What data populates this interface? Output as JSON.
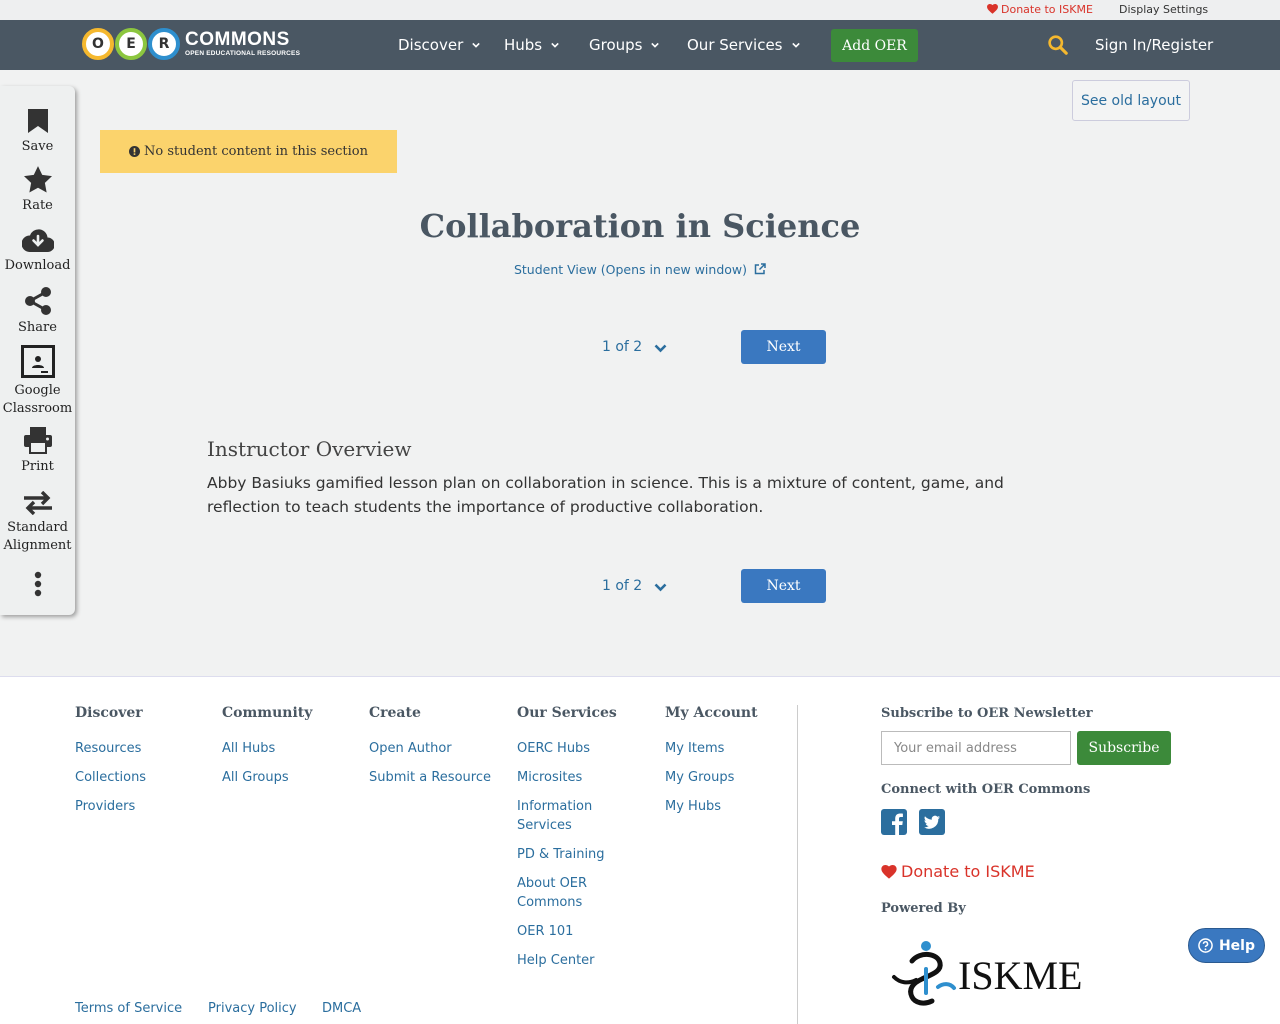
{
  "utility": {
    "donate": "Donate to ISKME",
    "display_settings": "Display Settings"
  },
  "logo": {
    "letters": [
      "O",
      "E",
      "R"
    ],
    "wordmark": "COMMONS",
    "tagline": "OPEN EDUCATIONAL RESOURCES"
  },
  "nav": {
    "items": [
      {
        "label": "Discover"
      },
      {
        "label": "Hubs"
      },
      {
        "label": "Groups"
      },
      {
        "label": "Our Services"
      }
    ],
    "add_oer": "Add OER",
    "sign_in": "Sign In/Register"
  },
  "tools": [
    {
      "label": "Save",
      "icon": "bookmark-icon"
    },
    {
      "label": "Rate",
      "icon": "star-icon"
    },
    {
      "label": "Download",
      "icon": "cloud-download-icon"
    },
    {
      "label": "Share",
      "icon": "share-icon"
    },
    {
      "label": "Google Classroom",
      "icon": "google-classroom-icon"
    },
    {
      "label": "Print",
      "icon": "print-icon"
    },
    {
      "label": "Standard Alignment",
      "icon": "exchange-icon"
    },
    {
      "label": "",
      "icon": "more-vertical-icon"
    }
  ],
  "see_old_layout": "See old layout",
  "notice": "No student content in this section",
  "title": "Collaboration in Science",
  "student_view": "Student View (Opens in new window)",
  "pager": {
    "label": "1 of 2",
    "next": "Next"
  },
  "section": {
    "title": "Instructor Overview",
    "body": "Abby Basiuks gamified lesson plan on collaboration in science. This is a mixture of content, game, and reflection to teach students the importance of productive collaboration."
  },
  "footer": {
    "columns": [
      {
        "title": "Discover",
        "links": [
          "Resources",
          "Collections",
          "Providers"
        ]
      },
      {
        "title": "Community",
        "links": [
          "All Hubs",
          "All Groups"
        ]
      },
      {
        "title": "Create",
        "links": [
          "Open Author",
          "Submit a Resource"
        ]
      },
      {
        "title": "Our Services",
        "links": [
          "OERC Hubs",
          "Microsites",
          "Information Services",
          "PD & Training",
          "About OER Commons",
          "OER 101",
          "Help Center"
        ]
      },
      {
        "title": "My Account",
        "links": [
          "My Items",
          "My Groups",
          "My Hubs"
        ]
      }
    ],
    "newsletter_title": "Subscribe to OER Newsletter",
    "email_placeholder": "Your email address",
    "subscribe": "Subscribe",
    "connect_title": "Connect with OER Commons",
    "donate": "Donate to ISKME",
    "powered_by": "Powered By",
    "iskme_logo": "ISKME",
    "bottom_links": [
      "Terms of Service",
      "Privacy Policy",
      "DMCA"
    ]
  },
  "help": "Help",
  "colors": {
    "navbar": "#4a5763",
    "green": "#3c8a3a",
    "blue": "#3a78c0",
    "link": "#2b6e9e",
    "notice": "#fbd36c",
    "donate": "#d9332a"
  }
}
